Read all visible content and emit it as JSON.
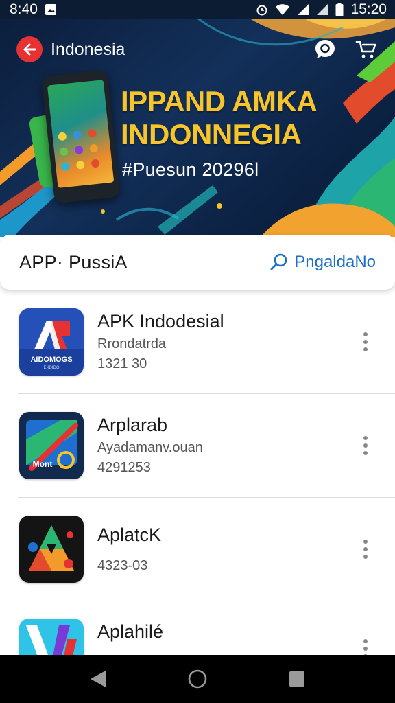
{
  "status_bar": {
    "time_left": "8:40",
    "time_right": "15:20"
  },
  "banner": {
    "country_label": "Indonesia",
    "headline_line1": "IPPAND AMKA",
    "headline_line2": "INDONNEGIA",
    "tagline": "#Puesun 20296l"
  },
  "section": {
    "title": "APP· PussiA",
    "link_label": "PngaldaNo"
  },
  "apps": [
    {
      "name": "APK Indodesial",
      "subtitle": "Rrondatrda",
      "meta": "1321 30",
      "icon": "apk-red-a-icon"
    },
    {
      "name": "Arplarab",
      "subtitle": "Ayadamanv.ouan",
      "meta": "4291253",
      "icon": "maps-slash-icon"
    },
    {
      "name": "AplatcK",
      "subtitle": "",
      "meta": "4323-03",
      "icon": "triangle-drive-icon"
    },
    {
      "name": "Aplahilé",
      "subtitle": "",
      "meta": "",
      "icon": "blue-v-icon"
    }
  ],
  "colors": {
    "banner_dark": "#0b1d3a",
    "headline_yellow": "#f7c52b",
    "back_button_red": "#e63232",
    "link_blue": "#1b6fc4"
  },
  "icons": {
    "back": "arrow-left-icon",
    "chat": "chat-bubble-icon",
    "cart": "shopping-cart-icon",
    "search": "search-icon",
    "more": "more-vertical-icon",
    "nav_back": "triangle-back-icon",
    "nav_home": "circle-home-icon",
    "nav_recents": "square-recents-icon"
  }
}
